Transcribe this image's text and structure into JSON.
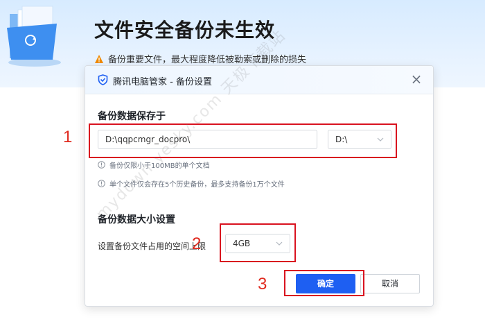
{
  "banner": {
    "title": "文件安全备份未生效",
    "warning": "备份重要文件，最大程度降低被勒索或删除的损失"
  },
  "dialog": {
    "title": "腾讯电脑管家 - 备份设置",
    "close_label": "×",
    "location_section": {
      "heading": "备份数据保存于",
      "path_value": "D:\\qqpcmgr_docpro\\",
      "drive_value": "D:\\",
      "notes": [
        "备份仅限小于100MB的单个文档",
        "单个文件仅会存在5个历史备份，最多支持备份1万个文件"
      ]
    },
    "size_section": {
      "heading": "备份数据大小设置",
      "label": "设置备份文件占用的空间上限",
      "size_value": "4GB"
    },
    "buttons": {
      "ok": "确定",
      "cancel": "取消"
    }
  },
  "annotations": [
    "1",
    "2",
    "3"
  ],
  "watermark": "mydown.yesky.com 天极下载站",
  "colors": {
    "accent": "#1e5ff2",
    "annotation_red": "#d9121f",
    "warning_orange": "#f08a00"
  }
}
